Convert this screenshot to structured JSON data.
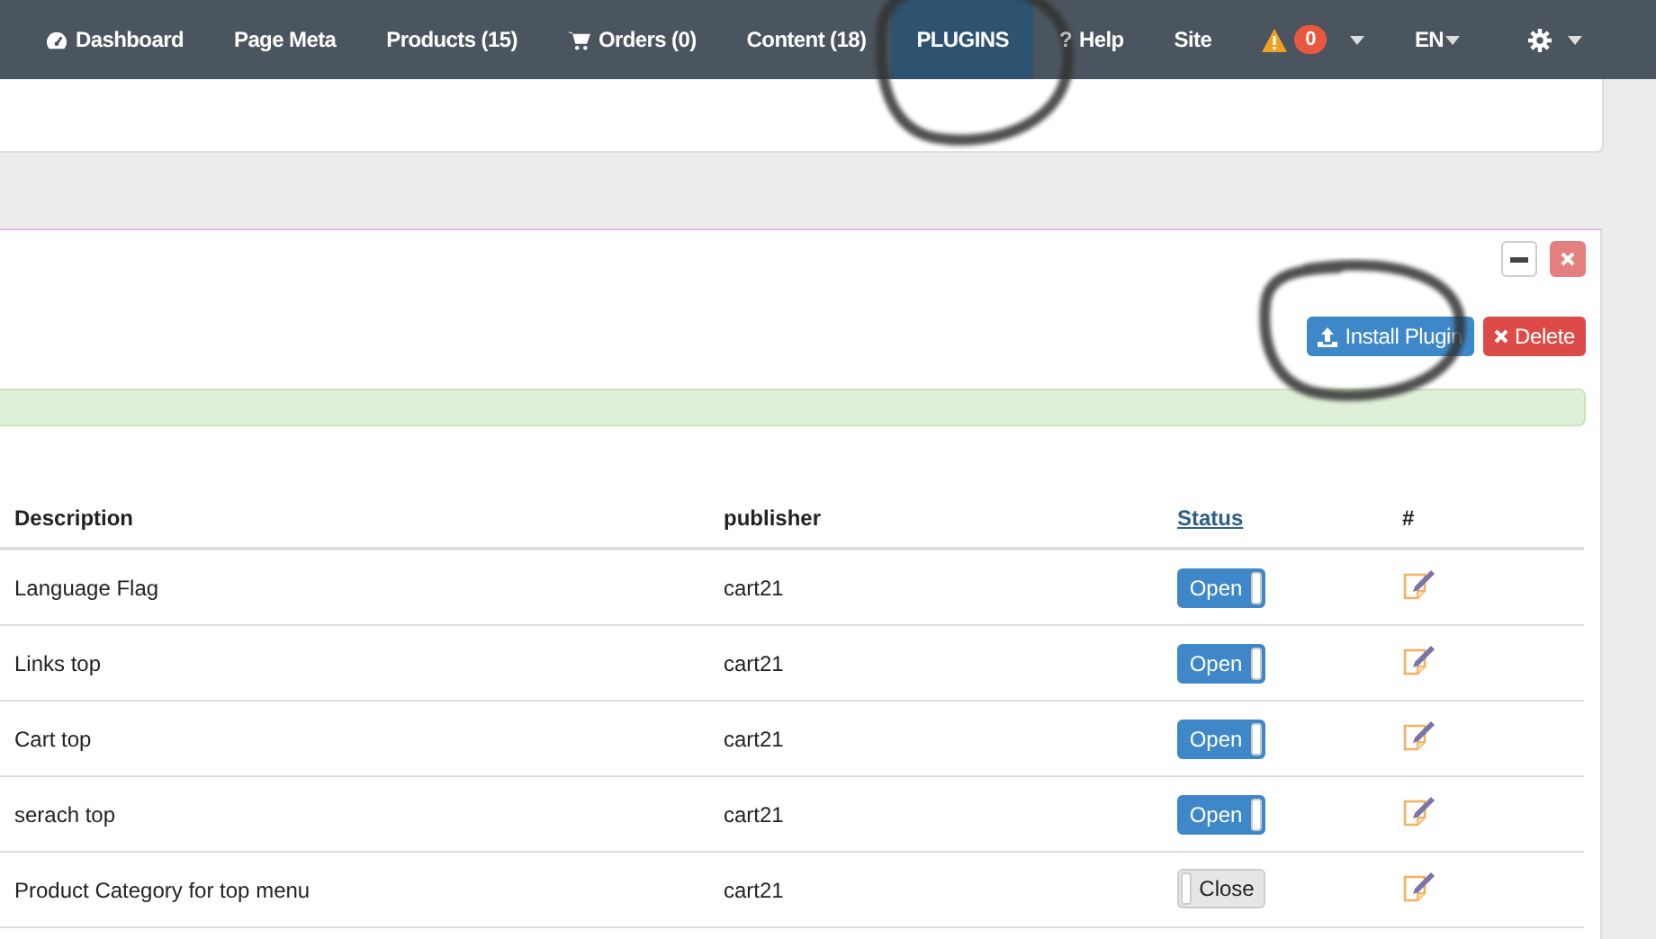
{
  "navbar": {
    "items": [
      {
        "kind": "dashboard",
        "label": "Dashboard",
        "selected": false,
        "circled": false
      },
      {
        "kind": "link",
        "label": "Page Meta",
        "selected": false,
        "circled": false
      },
      {
        "kind": "link",
        "label": "Products (15)",
        "selected": false,
        "circled": false
      },
      {
        "kind": "orders",
        "label": "Orders (0)",
        "selected": false,
        "circled": false
      },
      {
        "kind": "link",
        "label": "Content (18)",
        "selected": false,
        "circled": false
      },
      {
        "kind": "link",
        "label": "PLUGINS",
        "selected": true,
        "circled": true
      },
      {
        "kind": "help",
        "glyph": "?",
        "label": "Help",
        "selected": false,
        "circled": false
      },
      {
        "kind": "link",
        "label": "Site",
        "selected": false,
        "circled": false
      },
      {
        "kind": "alerts",
        "count": "0",
        "selected": false,
        "circled": false
      },
      {
        "kind": "dropdown",
        "label": "EN",
        "selected": false,
        "circled": false
      },
      {
        "kind": "settings",
        "selected": false,
        "circled": false
      }
    ]
  },
  "panel": {
    "actions": [
      {
        "kind": "install",
        "label": "Install Plugin",
        "circled": true
      },
      {
        "kind": "delete",
        "label": "Delete",
        "circled": false
      }
    ],
    "alert": {
      "kind": "success"
    },
    "table": {
      "columns": [
        {
          "label": "Description",
          "link": false
        },
        {
          "label": "publisher",
          "link": false
        },
        {
          "label": "Status",
          "link": true
        },
        {
          "label": "#",
          "link": false
        }
      ],
      "rows": [
        {
          "description": "Language Flag",
          "publisher": "cart21",
          "status": {
            "label": "Open",
            "on": true
          }
        },
        {
          "description": "Links top",
          "publisher": "cart21",
          "status": {
            "label": "Open",
            "on": true
          }
        },
        {
          "description": "Cart top",
          "publisher": "cart21",
          "status": {
            "label": "Open",
            "on": true
          }
        },
        {
          "description": "serach top",
          "publisher": "cart21",
          "status": {
            "label": "Open",
            "on": true
          }
        },
        {
          "description": "Product Category for top menu",
          "publisher": "cart21",
          "status": {
            "label": "Close",
            "on": false
          }
        }
      ]
    }
  }
}
